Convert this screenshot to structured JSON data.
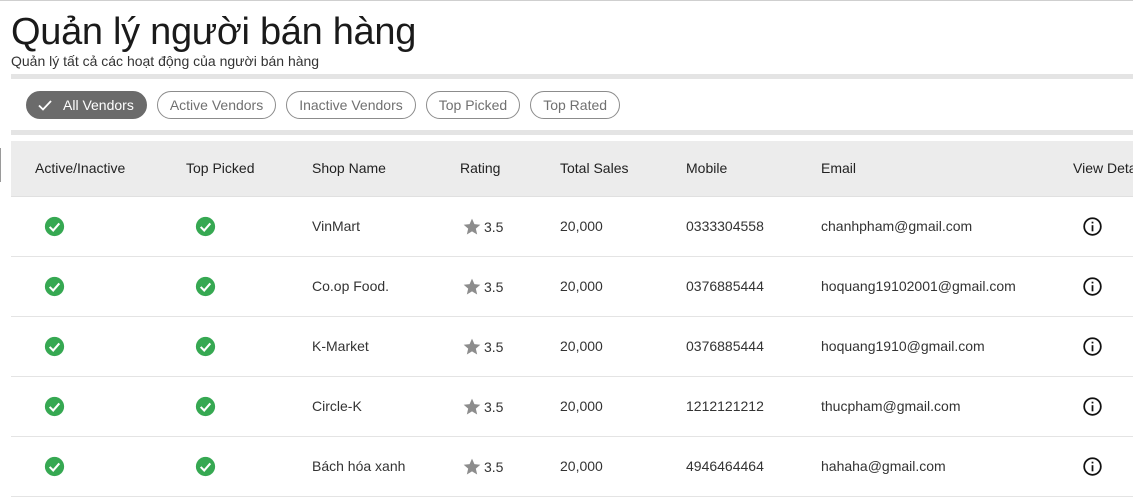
{
  "header": {
    "title": "Quản lý người bán hàng",
    "subtitle": "Quản lý tất cả các hoạt động của người bán hàng"
  },
  "filters": {
    "chips": [
      {
        "label": "All Vendors",
        "selected": true
      },
      {
        "label": "Active Vendors",
        "selected": false
      },
      {
        "label": "Inactive Vendors",
        "selected": false
      },
      {
        "label": "Top Picked",
        "selected": false
      },
      {
        "label": "Top Rated",
        "selected": false
      }
    ]
  },
  "table": {
    "columns": [
      "Active/Inactive",
      "Top Picked",
      "Shop Name",
      "Rating",
      "Total Sales",
      "Mobile",
      "Email",
      "View Deta"
    ],
    "rows": [
      {
        "active": true,
        "top_picked": true,
        "shop_name": "VinMart",
        "rating": "3.5",
        "total_sales": "20,000",
        "mobile": "0333304558",
        "email": "chanhpham@gmail.com"
      },
      {
        "active": true,
        "top_picked": true,
        "shop_name": "Co.op Food.",
        "rating": "3.5",
        "total_sales": "20,000",
        "mobile": "0376885444",
        "email": "hoquang19102001@gmail.com"
      },
      {
        "active": true,
        "top_picked": true,
        "shop_name": "K-Market",
        "rating": "3.5",
        "total_sales": "20,000",
        "mobile": "0376885444",
        "email": "hoquang1910@gmail.com"
      },
      {
        "active": true,
        "top_picked": true,
        "shop_name": "Circle-K",
        "rating": "3.5",
        "total_sales": "20,000",
        "mobile": "1212121212",
        "email": "thucpham@gmail.com"
      },
      {
        "active": true,
        "top_picked": true,
        "shop_name": "Bách hóa xanh",
        "rating": "3.5",
        "total_sales": "20,000",
        "mobile": "4946464464",
        "email": "hahaha@gmail.com"
      }
    ]
  },
  "icons": {
    "check": "check-icon",
    "status": "check-circle-icon",
    "star": "star-icon",
    "details": "info-icon"
  },
  "colors": {
    "status_green": "#36a852",
    "chip_selected_bg": "#6b6b6b",
    "star_gray": "#8d8d8d"
  }
}
